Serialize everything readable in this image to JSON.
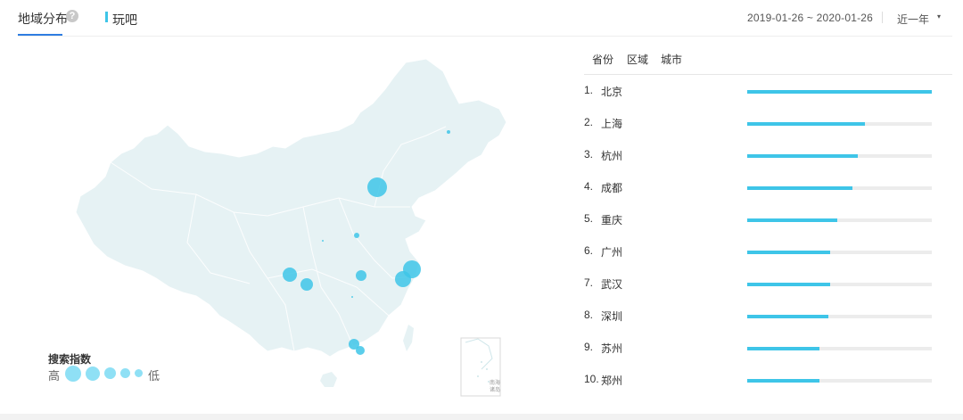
{
  "header": {
    "tab_label": "地域分布",
    "help_icon": "question-icon",
    "keyword": "玩吧",
    "date_range": "2019-01-26 ~ 2020-01-26",
    "period": "近一年",
    "period_caret": "▾"
  },
  "colors": {
    "accent": "#3ec5e8",
    "tab_underline": "#2f7de1",
    "map_fill": "#e6f2f4",
    "bubble": "#3ec5e8"
  },
  "map": {
    "inset_label_line1": "南海",
    "inset_label_line2": "诸岛"
  },
  "legend": {
    "title": "搜索指数",
    "high": "高",
    "low": "低"
  },
  "region_tabs": [
    "省份",
    "区域",
    "城市"
  ],
  "ranking": [
    {
      "rank": "1.",
      "city": "北京",
      "value": 1.0
    },
    {
      "rank": "2.",
      "city": "上海",
      "value": 0.64
    },
    {
      "rank": "3.",
      "city": "杭州",
      "value": 0.6
    },
    {
      "rank": "4.",
      "city": "成都",
      "value": 0.57
    },
    {
      "rank": "5.",
      "city": "重庆",
      "value": 0.49
    },
    {
      "rank": "6.",
      "city": "广州",
      "value": 0.45
    },
    {
      "rank": "7.",
      "city": "武汉",
      "value": 0.45
    },
    {
      "rank": "8.",
      "city": "深圳",
      "value": 0.44
    },
    {
      "rank": "9.",
      "city": "苏州",
      "value": 0.39
    },
    {
      "rank": "10.",
      "city": "郑州",
      "value": 0.39
    }
  ]
}
